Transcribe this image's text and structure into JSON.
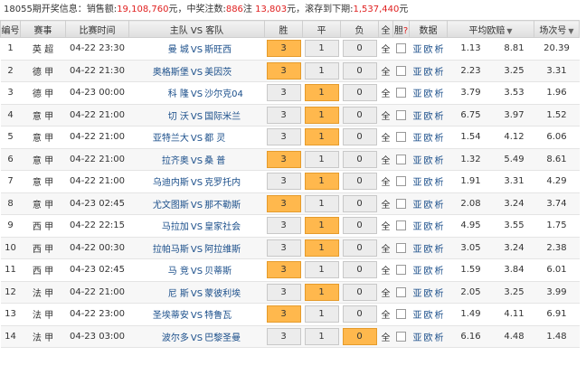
{
  "info": {
    "prefix": "18055期开奖信息：",
    "sales_label": "销售额:",
    "sales_value": "19,108,760",
    "sales_unit": "元，",
    "prize_label": "中奖注数:",
    "prize_value": "886",
    "prize_unit": "注",
    "prize_amount": "13,803",
    "prize_amount_unit": "元，",
    "roll_label": "滚存到下期:",
    "roll_value": "1,537,440",
    "roll_unit": "元"
  },
  "headers": {
    "no": "编号",
    "league": "赛事",
    "time": "比赛时间",
    "match": "主队 VS 客队",
    "win": "胜",
    "draw": "平",
    "lose": "负",
    "all": "全",
    "dan": "胆",
    "dan_q": "?",
    "data": "数据",
    "avg_odds": "平均欧赔",
    "rank": "场次号"
  },
  "rows": [
    {
      "no": "1",
      "league": "英 超",
      "time": "04-22 23:30",
      "home": "曼 城",
      "away": "斯旺西",
      "w": "3",
      "d": "1",
      "l": "0",
      "sel": "w",
      "o1": "1.13",
      "o2": "8.81",
      "o3": "20.39"
    },
    {
      "no": "2",
      "league": "德 甲",
      "time": "04-22 21:30",
      "home": "奥格斯堡",
      "away": "美因茨",
      "w": "3",
      "d": "1",
      "l": "0",
      "sel": "w",
      "o1": "2.23",
      "o2": "3.25",
      "o3": "3.31"
    },
    {
      "no": "3",
      "league": "德 甲",
      "time": "04-23 00:00",
      "home": "科 隆",
      "away": "沙尔克04",
      "w": "3",
      "d": "1",
      "l": "0",
      "sel": "d",
      "o1": "3.79",
      "o2": "3.53",
      "o3": "1.96"
    },
    {
      "no": "4",
      "league": "意 甲",
      "time": "04-22 21:00",
      "home": "切 沃",
      "away": "国际米兰",
      "w": "3",
      "d": "1",
      "l": "0",
      "sel": "d",
      "o1": "6.75",
      "o2": "3.97",
      "o3": "1.52"
    },
    {
      "no": "5",
      "league": "意 甲",
      "time": "04-22 21:00",
      "home": "亚特兰大",
      "away": "都 灵",
      "w": "3",
      "d": "1",
      "l": "0",
      "sel": "d",
      "o1": "1.54",
      "o2": "4.12",
      "o3": "6.06"
    },
    {
      "no": "6",
      "league": "意 甲",
      "time": "04-22 21:00",
      "home": "拉齐奥",
      "away": "桑 普",
      "w": "3",
      "d": "1",
      "l": "0",
      "sel": "w",
      "o1": "1.32",
      "o2": "5.49",
      "o3": "8.61"
    },
    {
      "no": "7",
      "league": "意 甲",
      "time": "04-22 21:00",
      "home": "乌迪内斯",
      "away": "克罗托内",
      "w": "3",
      "d": "1",
      "l": "0",
      "sel": "d",
      "o1": "1.91",
      "o2": "3.31",
      "o3": "4.29"
    },
    {
      "no": "8",
      "league": "意 甲",
      "time": "04-23 02:45",
      "home": "尤文图斯",
      "away": "那不勒斯",
      "w": "3",
      "d": "1",
      "l": "0",
      "sel": "w",
      "o1": "2.08",
      "o2": "3.24",
      "o3": "3.74"
    },
    {
      "no": "9",
      "league": "西 甲",
      "time": "04-22 22:15",
      "home": "马拉加",
      "away": "皇家社会",
      "w": "3",
      "d": "1",
      "l": "0",
      "sel": "d",
      "o1": "4.95",
      "o2": "3.55",
      "o3": "1.75"
    },
    {
      "no": "10",
      "league": "西 甲",
      "time": "04-22 00:30",
      "home": "拉帕马斯",
      "away": "阿拉维斯",
      "w": "3",
      "d": "1",
      "l": "0",
      "sel": "d",
      "o1": "3.05",
      "o2": "3.24",
      "o3": "2.38"
    },
    {
      "no": "11",
      "league": "西 甲",
      "time": "04-23 02:45",
      "home": "马 竞",
      "away": "贝蒂斯",
      "w": "3",
      "d": "1",
      "l": "0",
      "sel": "w",
      "o1": "1.59",
      "o2": "3.84",
      "o3": "6.01"
    },
    {
      "no": "12",
      "league": "法 甲",
      "time": "04-22 21:00",
      "home": "尼 斯",
      "away": "蒙彼利埃",
      "w": "3",
      "d": "1",
      "l": "0",
      "sel": "d",
      "o1": "2.05",
      "o2": "3.25",
      "o3": "3.99"
    },
    {
      "no": "13",
      "league": "法 甲",
      "time": "04-22 23:00",
      "home": "圣埃蒂安",
      "away": "特鲁瓦",
      "w": "3",
      "d": "1",
      "l": "0",
      "sel": "w",
      "o1": "1.49",
      "o2": "4.11",
      "o3": "6.91"
    },
    {
      "no": "14",
      "league": "法 甲",
      "time": "04-23 03:00",
      "home": "波尔多",
      "away": "巴黎圣曼",
      "w": "3",
      "d": "1",
      "l": "0",
      "sel": "l",
      "o1": "6.16",
      "o2": "4.48",
      "o3": "1.48"
    }
  ],
  "labels": {
    "vs": "VS",
    "quan": "全",
    "ya": "亚",
    "ou": "欧",
    "xi": "析"
  },
  "colors": {
    "selected": "#ffb84d",
    "accent_red": "#e02020",
    "team_blue": "#1a4e8a"
  }
}
